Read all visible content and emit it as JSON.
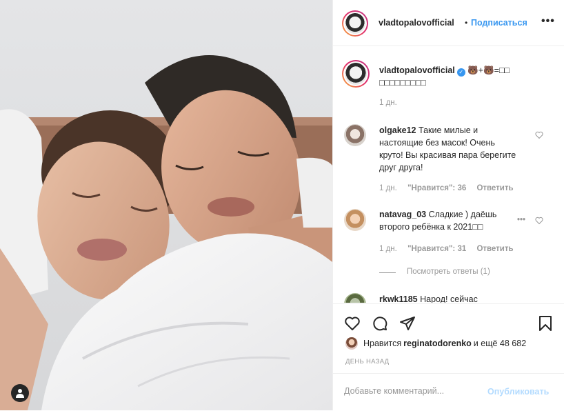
{
  "post": {
    "author": "vladtopalovofficial",
    "dot": "•",
    "follow_label": "Подписаться",
    "more_label": "•••",
    "caption": "🐻+🐻=□□ □□□□□□□□□",
    "caption_time": "1 дн."
  },
  "comments": [
    {
      "user": "olgake12",
      "text": "Такие милые и настоящие без масок! Очень круто! Вы красивая пара берегите друг друга!",
      "time": "1 дн.",
      "likes": "\"Нравится\": 36",
      "reply": "Ответить"
    },
    {
      "user": "natavag_03",
      "text": "Сладкие ) даёшь второго ребёнка к 2021□□",
      "time": "1 дн.",
      "likes": "\"Нравится\": 31",
      "reply": "Ответить",
      "view_replies": "Посмотреть ответы (1)"
    },
    {
      "user": "rkwk1185",
      "text": "Народ! сейчас"
    }
  ],
  "likes": {
    "prefix": "Нравится",
    "user": "reginatodorenko",
    "suffix": "и ещё 48 682"
  },
  "date_label": "ДЕНЬ НАЗАД",
  "add_comment": {
    "placeholder": "Добавьте комментарий...",
    "publish_label": "Опубликовать"
  },
  "icons": [
    "user-tag-icon",
    "heart-icon",
    "comment-icon",
    "share-icon",
    "bookmark-icon",
    "verified-icon",
    "more-icon"
  ],
  "colors": {
    "accent": "#3897f0",
    "publish_disabled": "#b3dbff",
    "muted": "#999999"
  }
}
